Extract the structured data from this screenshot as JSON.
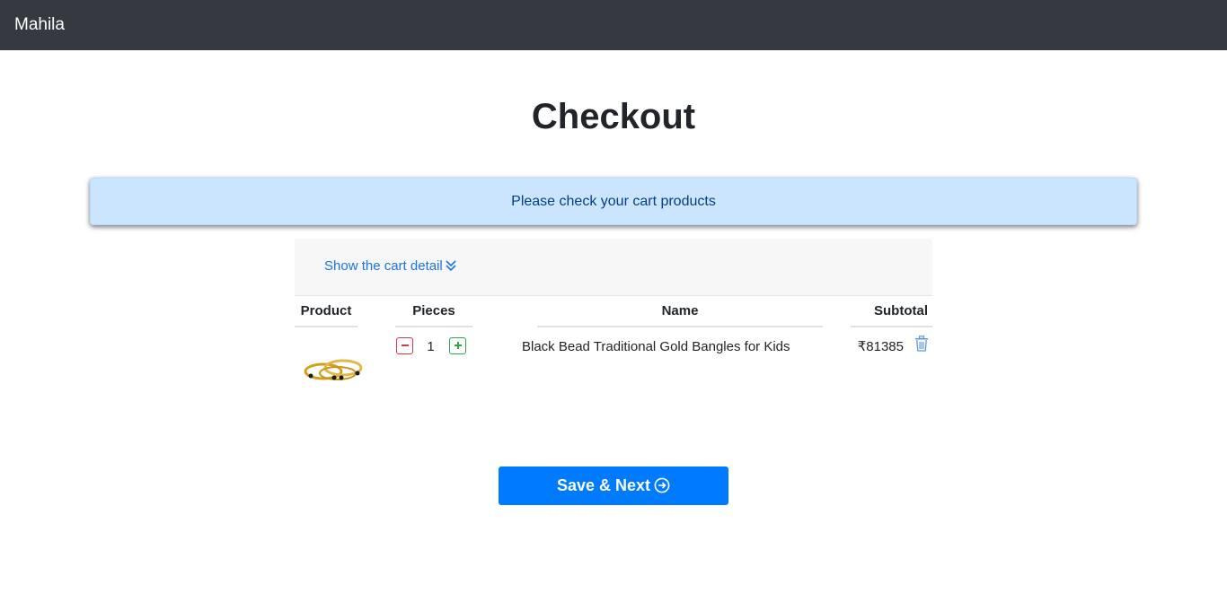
{
  "navbar": {
    "brand": "Mahila"
  },
  "page": {
    "title": "Checkout"
  },
  "alert": {
    "message": "Please check your cart products"
  },
  "cart": {
    "toggle_label": "Show the cart detail",
    "columns": {
      "product": "Product",
      "pieces": "Pieces",
      "name": "Name",
      "subtotal": "Subtotal"
    },
    "items": [
      {
        "quantity": "1",
        "name": "Black Bead Traditional Gold Bangles for Kids",
        "subtotal": "₹81385"
      }
    ]
  },
  "actions": {
    "save_next_label": "Save & Next"
  },
  "colors": {
    "navbar": "#343a40",
    "alert_bg": "#cce5ff",
    "primary": "#007bff",
    "danger": "#dc3545",
    "success": "#28a745"
  }
}
